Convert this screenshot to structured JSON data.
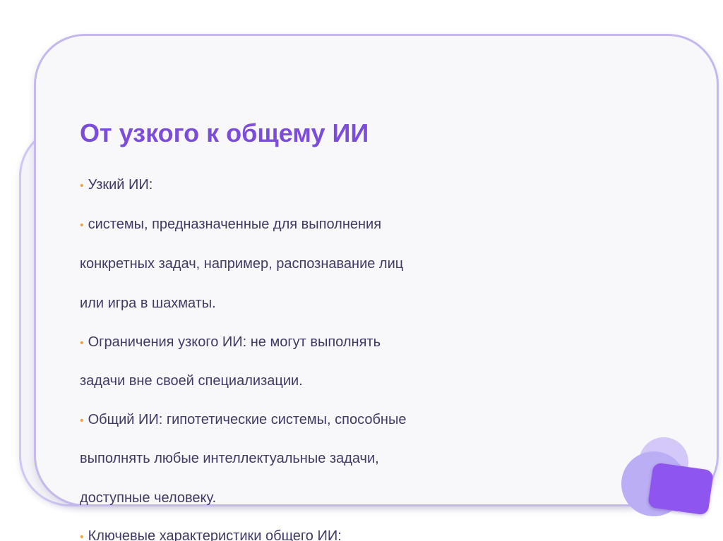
{
  "slide": {
    "title": "От узкого к общему ИИ",
    "bullet_symbol": "•",
    "lines": [
      {
        "bullet": true,
        "text": "Узкий ИИ:"
      },
      {
        "bullet": true,
        "text": "системы, предназначенные для выполнения"
      },
      {
        "bullet": false,
        "text": "конкретных задач, например, распознавание лиц"
      },
      {
        "bullet": false,
        "text": "или игра в шахматы."
      },
      {
        "bullet": true,
        "text": "Ограничения узкого ИИ: не могут выполнять"
      },
      {
        "bullet": false,
        "text": "задачи вне своей специализации."
      },
      {
        "bullet": true,
        "text": "Общий ИИ: гипотетические системы, способные"
      },
      {
        "bullet": false,
        "text": "выполнять любые интеллектуальные задачи,"
      },
      {
        "bullet": false,
        "text": "доступные человеку."
      },
      {
        "bullet": true,
        "text": "Ключевые характеристики общего ИИ:"
      }
    ]
  },
  "colors": {
    "title": "#7c4ddb",
    "text": "#3f3a63",
    "bullet": "#f0a340",
    "card_border": "#c5b8ef",
    "accent_square": "#8e56ef"
  }
}
